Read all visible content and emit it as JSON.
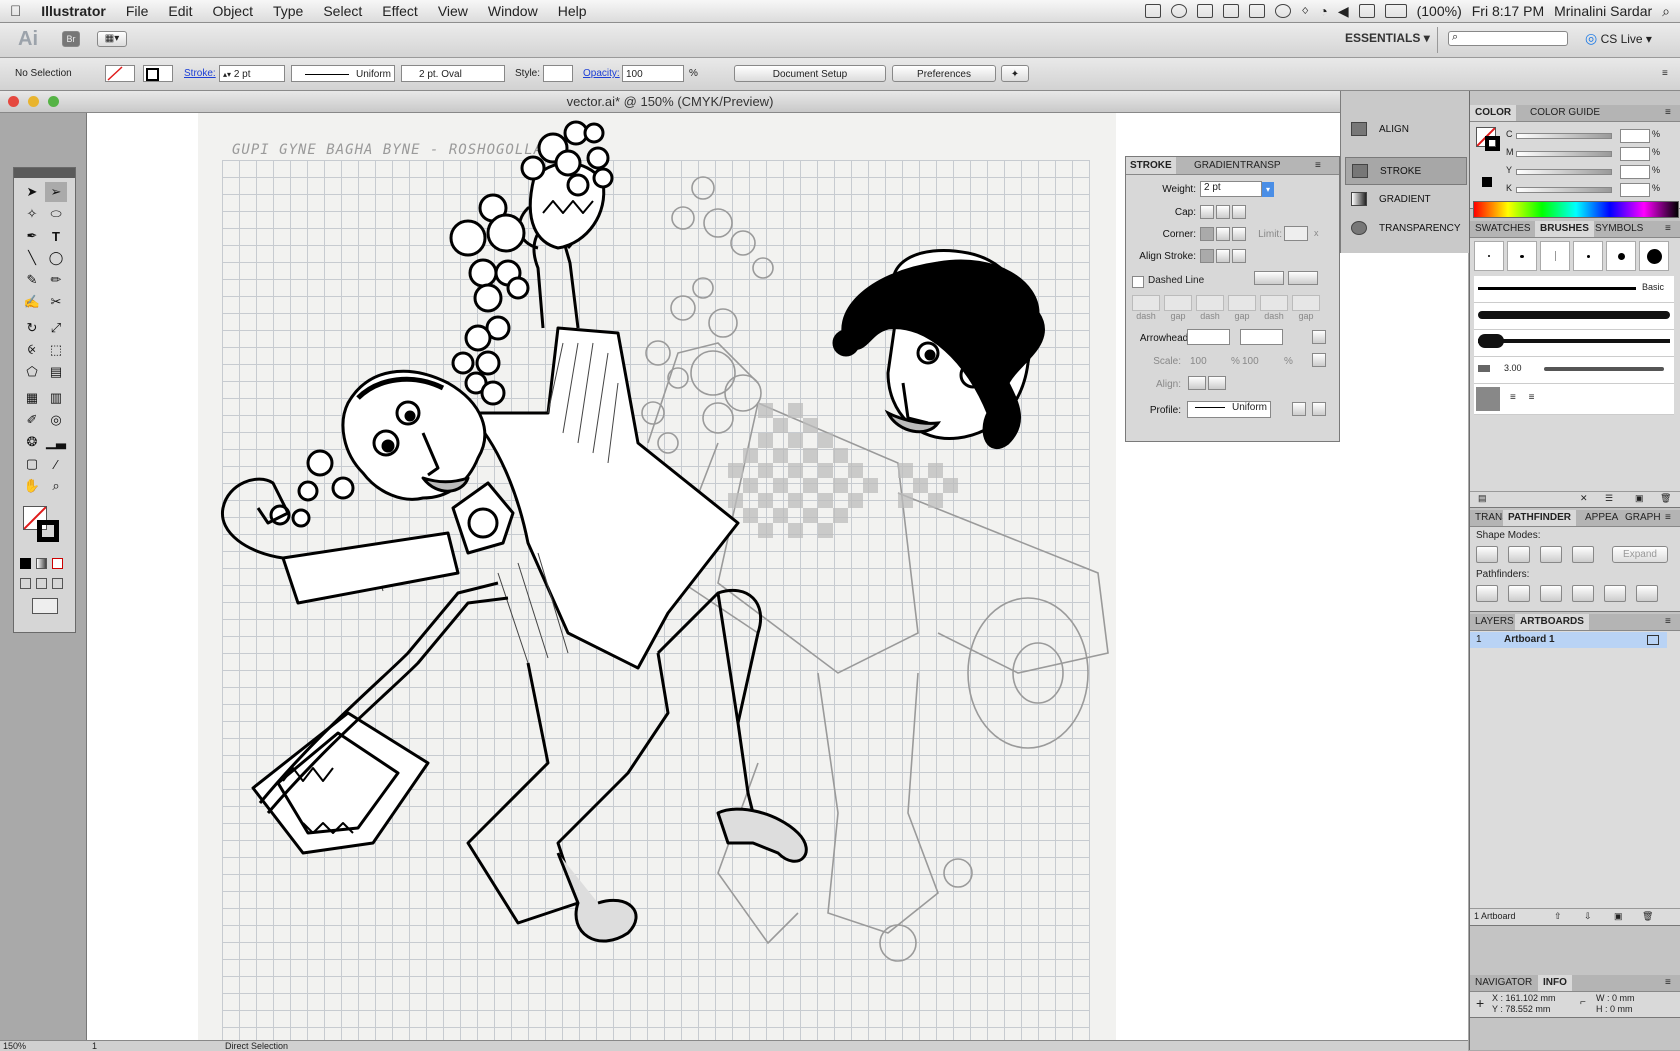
{
  "menubar": {
    "app": "Illustrator",
    "items": [
      "File",
      "Edit",
      "Object",
      "Type",
      "Select",
      "Effect",
      "View",
      "Window",
      "Help"
    ],
    "battery": "(100%)",
    "clock": "Fri 8:17 PM",
    "user": "Mrinalini Sardar"
  },
  "appbar": {
    "logo": "Ai",
    "bridge": "Br",
    "workspace": "ESSENTIALS",
    "search_placeholder": "",
    "cslive": "CS Live"
  },
  "control": {
    "selection": "No Selection",
    "stroke_label": "Stroke:",
    "stroke_weight": "2 pt",
    "profile": "Uniform",
    "brush": "2 pt. Oval",
    "style_label": "Style:",
    "opacity_label": "Opacity:",
    "opacity_value": "100",
    "percent": "%",
    "doc_setup": "Document Setup",
    "preferences": "Preferences"
  },
  "document": {
    "title": "vector.ai* @ 150% (CMYK/Preview)",
    "sketch_title": "GUPI GYNE BAGHA BYNE - ROSHOGOLLA"
  },
  "dock": {
    "items": [
      "ALIGN",
      "STROKE",
      "GRADIENT",
      "TRANSPARENCY"
    ]
  },
  "stroke_panel": {
    "tabs": [
      "STROKE",
      "GRADIEN",
      "TRANSP"
    ],
    "weight_label": "Weight:",
    "weight_value": "2 pt",
    "cap_label": "Cap:",
    "corner_label": "Corner:",
    "limit_label": "Limit:",
    "limit_x": "x",
    "align_label": "Align Stroke:",
    "dashed_label": "Dashed Line",
    "dash_labels": [
      "dash",
      "gap",
      "dash",
      "gap",
      "dash",
      "gap"
    ],
    "arrowheads_label": "Arrowheads:",
    "scale_label": "Scale:",
    "scale_1": "100",
    "scale_2": "100",
    "pct": "%",
    "align2_label": "Align:",
    "profile_label": "Profile:",
    "profile_value": "Uniform"
  },
  "color_panel": {
    "tabs": [
      "COLOR",
      "COLOR GUIDE"
    ],
    "channels": [
      "C",
      "M",
      "Y",
      "K"
    ],
    "pct": "%"
  },
  "brushes_panel": {
    "tabs": [
      "SWATCHES",
      "BRUSHES",
      "SYMBOLS"
    ],
    "basic_label": "Basic",
    "size_label": "3.00"
  },
  "pathfinder_panel": {
    "tabs": [
      "TRANS",
      "PATHFINDER",
      "APPEA",
      "GRAPH"
    ],
    "shape_modes": "Shape Modes:",
    "expand": "Expand",
    "pathfinders": "Pathfinders:"
  },
  "layers_panel": {
    "tabs": [
      "LAYERS",
      "ARTBOARDS"
    ],
    "row_num": "1",
    "row_name": "Artboard 1",
    "footer": "1 Artboard"
  },
  "info_panel": {
    "tabs": [
      "NAVIGATOR",
      "INFO"
    ],
    "x": "X :  161.102 mm",
    "y": "Y :  78.552 mm",
    "w": "W :  0 mm",
    "h": "H :  0 mm"
  },
  "statusbar": {
    "zoom": "150%",
    "artboard": "1",
    "tool": "Direct Selection"
  },
  "colors": {
    "accent": "#4a8ee6",
    "link": "#1c3fd6",
    "selected_row": "#b9d3f5"
  }
}
